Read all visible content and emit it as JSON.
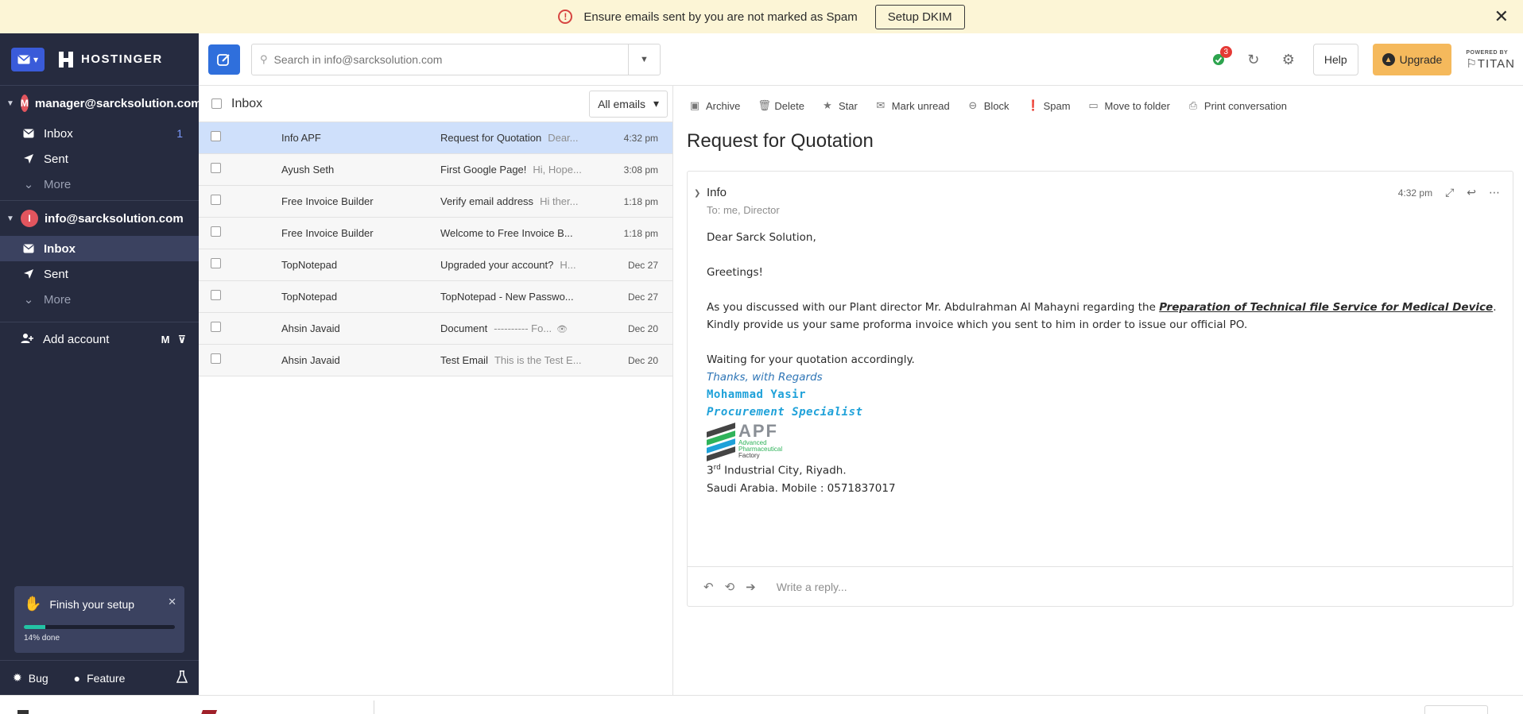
{
  "banner": {
    "message": "Ensure emails sent by you are not marked as Spam",
    "button": "Setup DKIM",
    "icon": "alert-circle-icon",
    "close": "✕"
  },
  "sidebar": {
    "logo_text": "HOSTINGER",
    "accounts": [
      {
        "initial": "M",
        "email": "manager@sarcksolution.com",
        "items": [
          {
            "label": "Inbox",
            "count": "1"
          },
          {
            "label": "Sent"
          },
          {
            "label": "More"
          }
        ]
      },
      {
        "initial": "I",
        "email": "info@sarcksolution.com",
        "items": [
          {
            "label": "Inbox"
          },
          {
            "label": "Sent"
          },
          {
            "label": "More"
          }
        ]
      }
    ],
    "add_account": "Add account",
    "setup": {
      "title": "Finish your setup",
      "progress_percent": 14,
      "progress_label": "14% done"
    },
    "footer": {
      "bug": "Bug",
      "feature": "Feature"
    }
  },
  "toolbar": {
    "search_placeholder": "Search in info@sarcksolution.com",
    "notification_count": "3",
    "help": "Help",
    "upgrade": "Upgrade",
    "powered_by": "POWERED BY",
    "titan": "TITAN"
  },
  "list": {
    "title": "Inbox",
    "filter": "All emails",
    "rows": [
      {
        "from": "Info APF",
        "subject": "Request for Quotation",
        "preview": "Dear...",
        "time": "4:32 pm"
      },
      {
        "from": "Ayush Seth",
        "subject": "First Google Page!",
        "preview": "Hi, Hope...",
        "time": "3:08 pm"
      },
      {
        "from": "Free Invoice Builder",
        "subject": "Verify email address",
        "preview": "Hi ther...",
        "time": "1:18 pm"
      },
      {
        "from": "Free Invoice Builder",
        "subject": "Welcome to Free Invoice B...",
        "preview": "",
        "time": "1:18 pm"
      },
      {
        "from": "TopNotepad",
        "subject": "Upgraded your account?",
        "preview": "H...",
        "time": "Dec 27"
      },
      {
        "from": "TopNotepad",
        "subject": "TopNotepad - New Passwo...",
        "preview": "",
        "time": "Dec 27"
      },
      {
        "from": "Ahsin Javaid",
        "subject": "Document",
        "preview": "---------- Fo...",
        "time": "Dec 20"
      },
      {
        "from": "Ahsin Javaid",
        "subject": "Test Email",
        "preview": "This is the Test E...",
        "time": "Dec 20"
      }
    ]
  },
  "reading": {
    "actions": [
      "Archive",
      "Delete",
      "Star",
      "Mark unread",
      "Block",
      "Spam",
      "Move to folder",
      "Print conversation"
    ],
    "subject": "Request for Quotation",
    "sender": "Info",
    "to": "To: me, Director",
    "time": "4:32 pm",
    "body": {
      "salutation": "Dear Sarck Solution,",
      "greeting": "Greetings!",
      "p1_before": "As you discussed with our Plant director Mr. Abdulrahman Al Mahayni regarding the ",
      "p1_emph": "Preparation of Technical file Service for Medical Device",
      "p1_after": ". Kindly provide us your same proforma invoice which you sent to him in order to issue our official PO.",
      "p2": "Waiting for your quotation accordingly.",
      "sig_thanks": "Thanks, with Regards",
      "sig_name": "Mohammad Yasir",
      "sig_role": "Procurement Specialist",
      "logo_big": "APF",
      "logo_line1": "Advanced",
      "logo_line2": "Pharmaceutical",
      "logo_line3": "Factory",
      "addr_num": "3",
      "addr_sup": "rd",
      "addr_rest": " Industrial City, Riyadh.",
      "addr2": "Saudi Arabia. Mobile : 0571837017"
    },
    "reply_placeholder": "Write a reply..."
  },
  "colors": {
    "sidebar_bg": "#262b3f",
    "accent": "#2f6fdc",
    "banner_bg": "#fcf5d6",
    "upgrade": "#f5b95c",
    "selected_row": "#cfe0fb"
  }
}
